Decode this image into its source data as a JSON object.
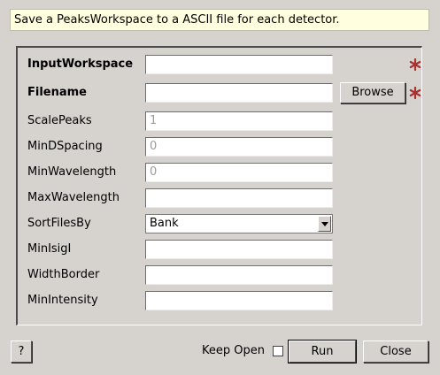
{
  "description": "Save a PeaksWorkspace to a ASCII file for each detector.",
  "fields": [
    {
      "label": "InputWorkspace",
      "value": "",
      "required": true
    },
    {
      "label": "Filename",
      "value": "",
      "required": true
    },
    {
      "label": "ScalePeaks",
      "value": "1"
    },
    {
      "label": "MinDSpacing",
      "value": "0"
    },
    {
      "label": "MinWavelength",
      "value": "0"
    },
    {
      "label": "MaxWavelength",
      "value": ""
    },
    {
      "label": "SortFilesBy",
      "value": "Bank"
    },
    {
      "label": "MinIsigI",
      "value": ""
    },
    {
      "label": "WidthBorder",
      "value": ""
    },
    {
      "label": "MinIntensity",
      "value": ""
    }
  ],
  "browse_label": "Browse",
  "help_label": "?",
  "keep_open_label": "Keep Open",
  "keep_open_checked": false,
  "run_label": "Run",
  "close_label": "Close",
  "colors": {
    "background": "#d6d2cd",
    "description_bg": "#ffffdf",
    "required_star": "#a83232"
  },
  "icons": {
    "required": "required-star-icon",
    "dropdown": "chevron-down-icon"
  }
}
